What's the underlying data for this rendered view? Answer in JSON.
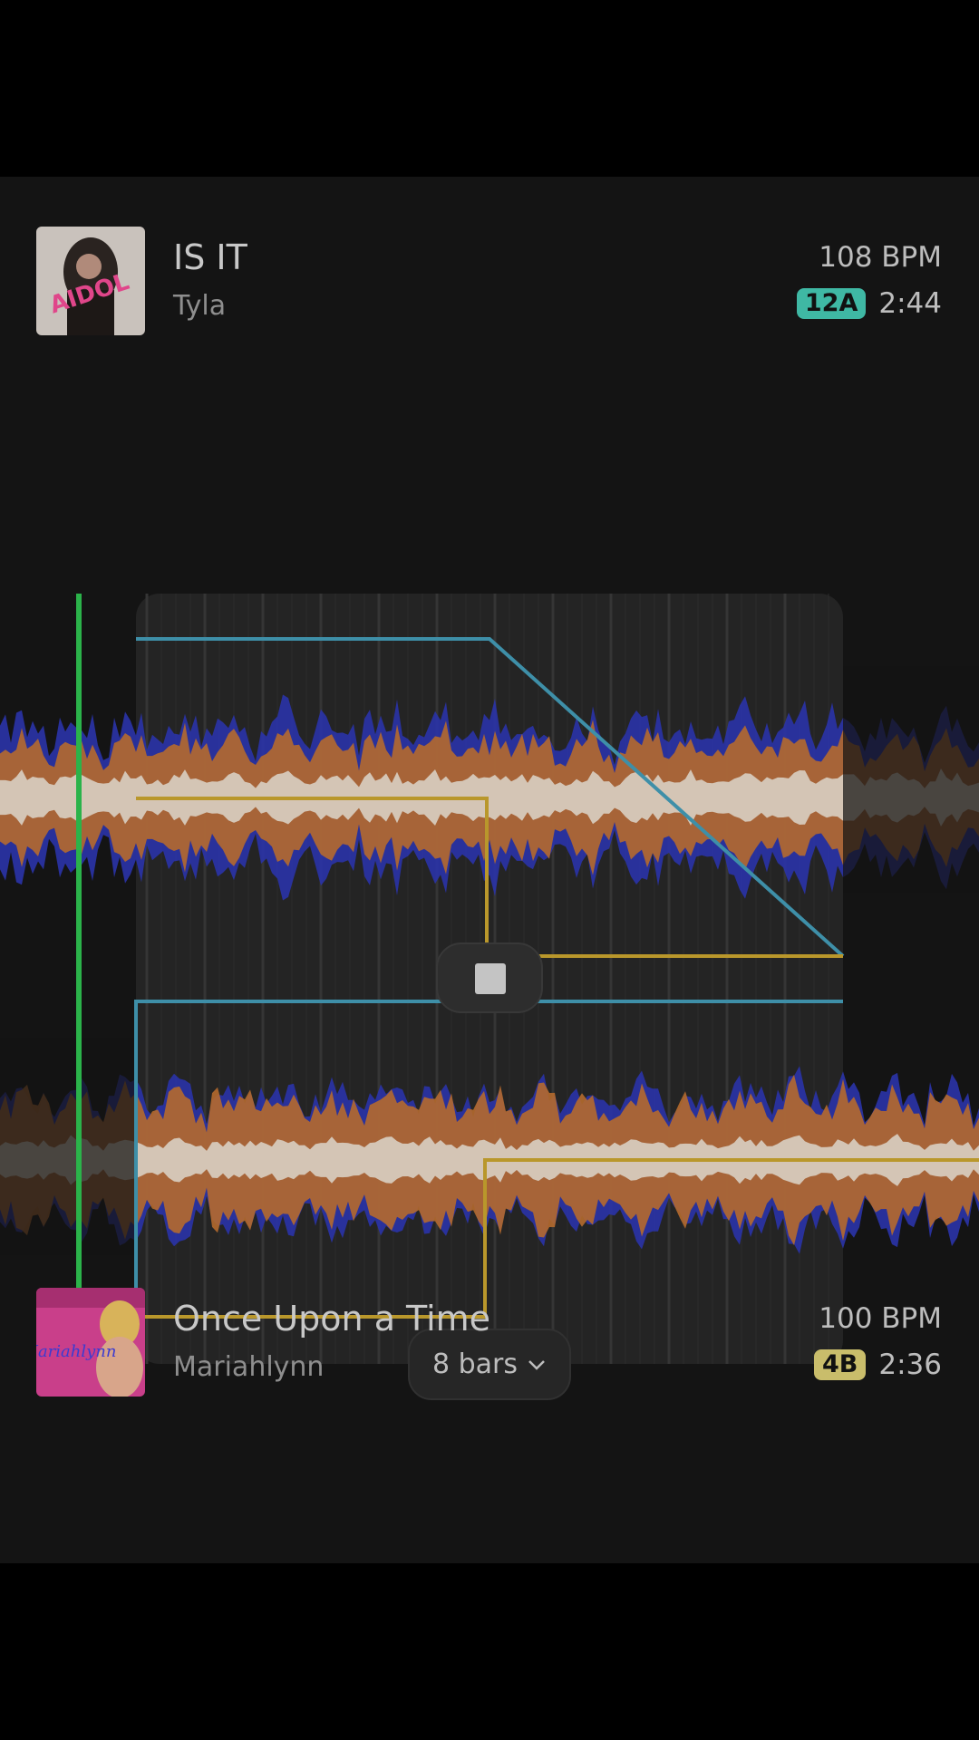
{
  "deck_a": {
    "title": "IS IT",
    "artist": "Tyla",
    "bpm": "108 BPM",
    "key": "12A",
    "key_color": "#3fb8a4",
    "duration": "2:44",
    "art_icon": "album-art-is-it",
    "art_text": "AIDOL"
  },
  "deck_b": {
    "title": "Once Upon a Time",
    "artist": "Mariahlynn",
    "bpm": "100 BPM",
    "key": "4B",
    "key_color": "#c9bd6b",
    "duration": "2:36",
    "art_icon": "album-art-once-upon-a-time",
    "art_text": "Mariahlynn"
  },
  "transition": {
    "length_label": "8 bars",
    "stop_icon": "stop-icon",
    "chevron_icon": "chevron-down-icon"
  },
  "colors": {
    "background": "#141414",
    "playhead": "#2bb34a",
    "volume_automation": "#3e8fa8",
    "eq_automation": "#b9972b",
    "wave_low": "#2a33a8",
    "wave_mid": "#b56a2e",
    "wave_high": "#d9cfc3"
  }
}
